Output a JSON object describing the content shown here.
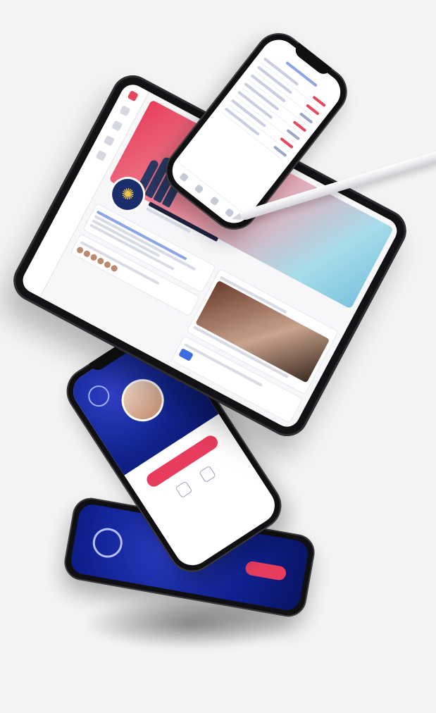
{
  "scene": {
    "description_colors": {
      "background": "#f4f4f5",
      "brand_blue": "#11248f",
      "accent_red": "#e73c5e",
      "device_frame": "#121214"
    }
  },
  "devices": {
    "tablet": {
      "screen": "social-profile-page"
    },
    "phone_top": {
      "screen": "list-view"
    },
    "phone_middle": {
      "screen": "login-profile"
    },
    "phone_bottom": {
      "screen": "splash"
    }
  },
  "icons": [
    "apple-pencil-icon",
    "brand-logo-icon",
    "profile-avatar-icon"
  ]
}
